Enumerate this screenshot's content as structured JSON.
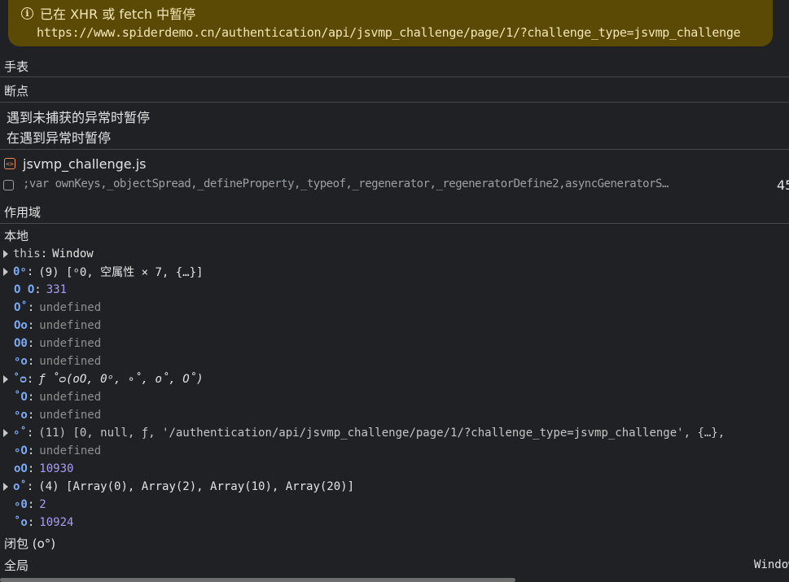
{
  "banner": {
    "title": "已在 XHR 或 fetch 中暂停",
    "url": "https://www.spiderdemo.cn/authentication/api/jsvmp_challenge/page/1/?challenge_type=jsvmp_challenge"
  },
  "sections": {
    "watch": "手表",
    "breakpoints": "断点",
    "scope": "作用域"
  },
  "breakpoints": {
    "uncaught": "遇到未捕获的异常时暂停",
    "caught": "在遇到异常时暂停",
    "file": "jsvmp_challenge.js",
    "code": ";var ownKeys,_objectSpread,_defineProperty,_typeof,_regenerator,_regeneratorDefine2,asyncGeneratorS…",
    "line": "45"
  },
  "scope": {
    "local_label": "本地",
    "closure_label": "闭包 (ο°)",
    "global_label": "全局",
    "global_value": "Window",
    "entries": [
      {
        "key": "this",
        "value": "Window",
        "kind": "obj",
        "expandable": true,
        "plain": true
      },
      {
        "key": "0ᵒ",
        "value": "(9)  [ᵒ0, 空属性 × 7, {…}]",
        "kind": "obj",
        "expandable": true
      },
      {
        "key": "Ο Ο",
        "value": "331",
        "kind": "num"
      },
      {
        "key": "Ο˚",
        "value": "undefined",
        "kind": "undef"
      },
      {
        "key": "Οο",
        "value": "undefined",
        "kind": "undef"
      },
      {
        "key": "Ο0",
        "value": "undefined",
        "kind": "undef"
      },
      {
        "key": "ᵒο",
        "value": "undefined",
        "kind": "undef"
      },
      {
        "key": "˚ᴑ",
        "value": "ƒ ˚ᴑ(oO, 0ᵒ, ∘˚, o˚, O˚)",
        "kind": "func",
        "expandable": true
      },
      {
        "key": "˚Ο",
        "value": "undefined",
        "kind": "undef"
      },
      {
        "key": "ᵒo",
        "value": "undefined",
        "kind": "undef"
      },
      {
        "key": "∘˚",
        "value": "(11)  [0, null, ƒ, '/authentication/api/jsvmp_challenge/page/1/?challenge_type=jsvmp_challenge', {…},",
        "kind": "arr",
        "expandable": true
      },
      {
        "key": "∘Ο",
        "value": "undefined",
        "kind": "undef"
      },
      {
        "key": "oO",
        "value": "10930",
        "kind": "num"
      },
      {
        "key": "o˚",
        "value": "(4)  [Array(0), Array(2), Array(10), Array(20)]",
        "kind": "obj",
        "expandable": true
      },
      {
        "key": "∘0",
        "value": "2",
        "kind": "num"
      },
      {
        "key": "˚o",
        "value": "10924",
        "kind": "num"
      }
    ]
  }
}
